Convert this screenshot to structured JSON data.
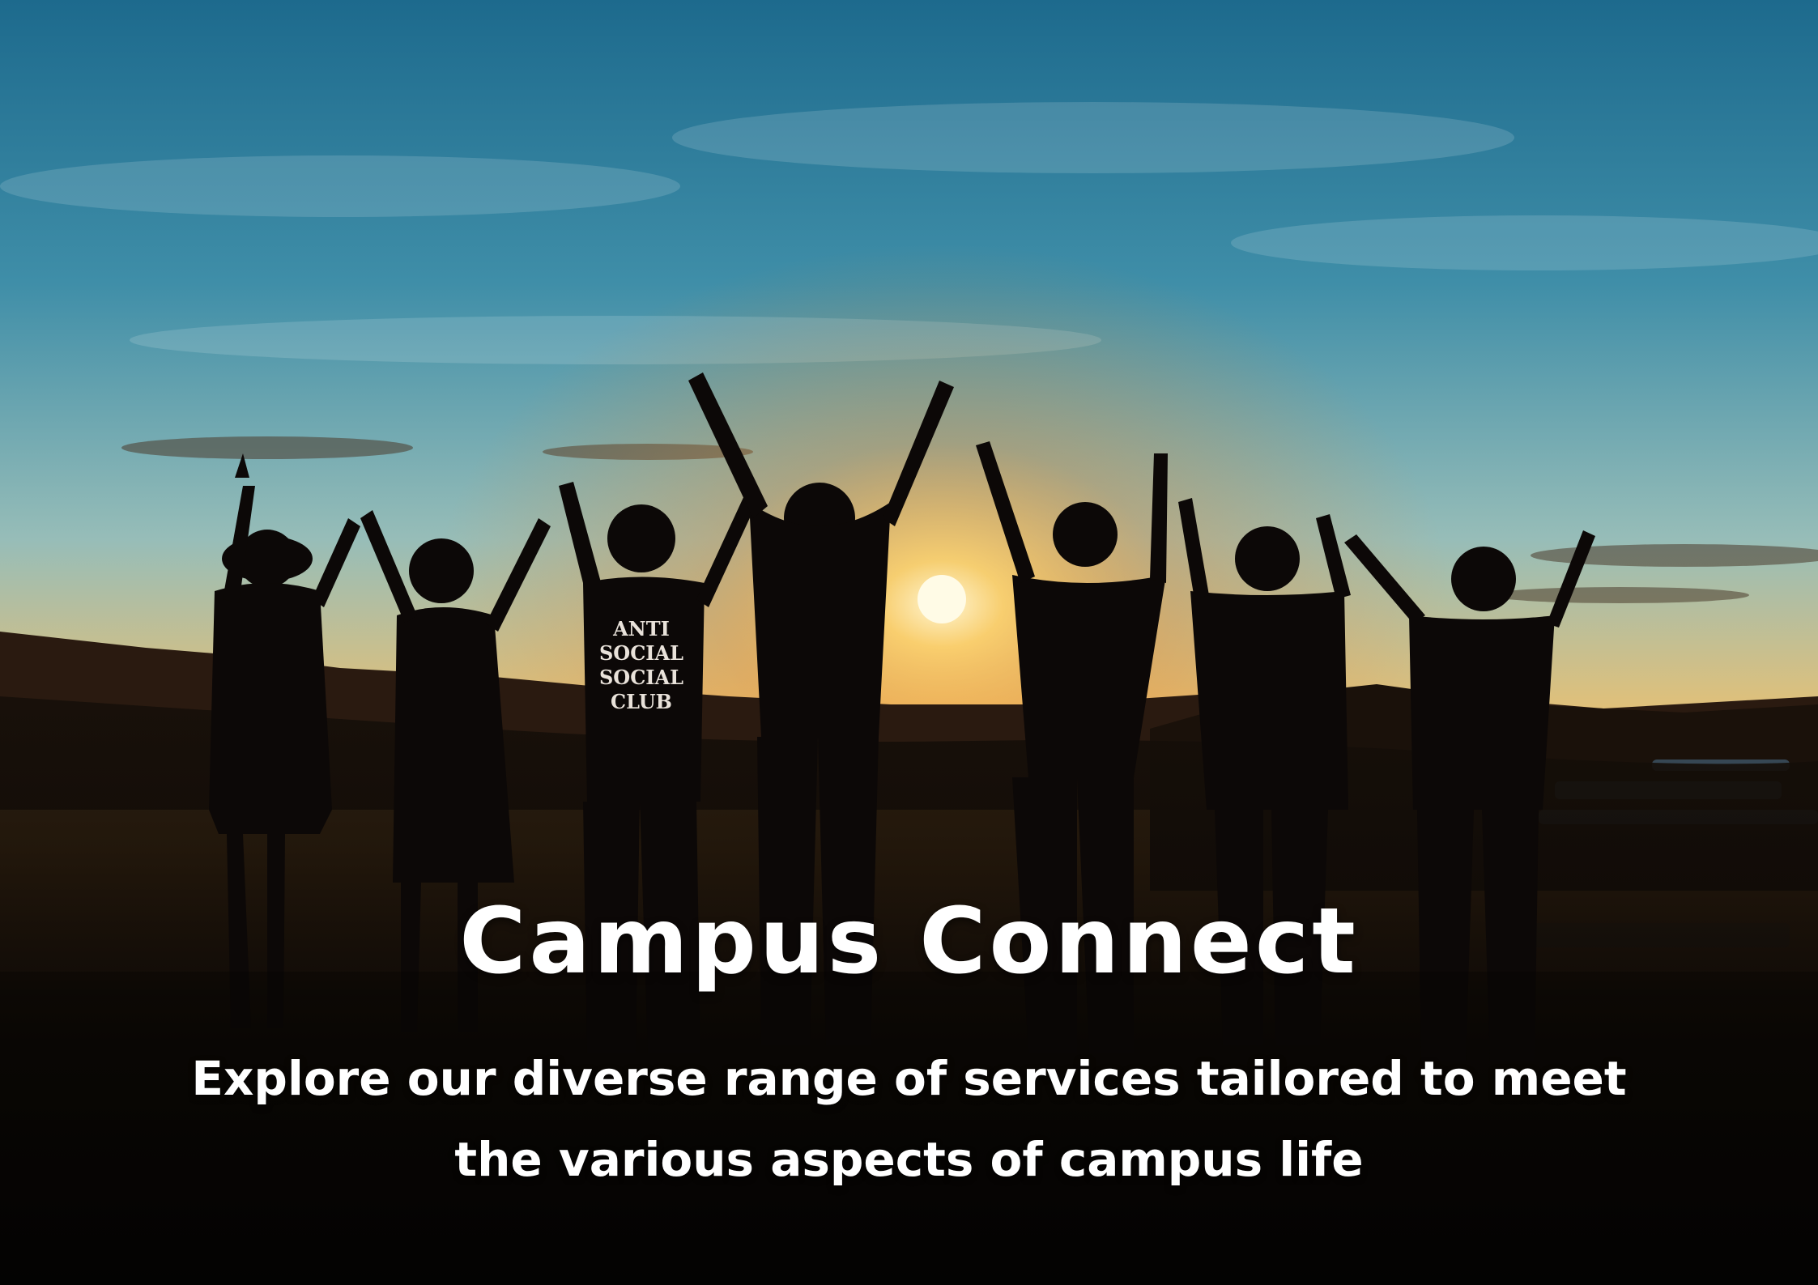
{
  "hero": {
    "title": "Campus Connect",
    "subtitle_line1": "Explore our diverse range of services tailored to meet",
    "subtitle_line2": "the various aspects of campus life",
    "text_color": "#ffffff"
  },
  "photo": {
    "subject": "silhouettes of seven friends raising their arms at sunset",
    "shirt_print": [
      "ANTI",
      "SOCIAL",
      "SOCIAL",
      "CLUB"
    ],
    "palette": {
      "sky_top": "#1f6d8f",
      "sky_mid": "#8fb9b7",
      "horizon": "#f2a23a",
      "sun": "#fff4c8",
      "ground": "#0b0806"
    }
  }
}
